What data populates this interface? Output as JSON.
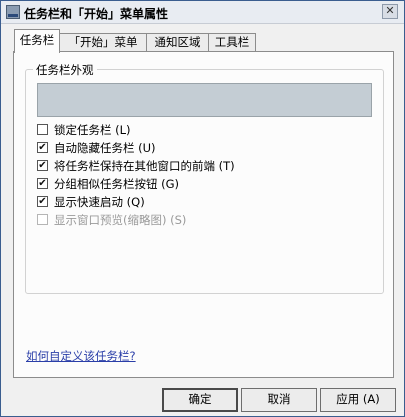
{
  "window": {
    "title": "任务栏和「开始」菜单属性",
    "close_glyph": "✕"
  },
  "tabs": [
    {
      "label": "任务栏",
      "active": true
    },
    {
      "label": "「开始」菜单",
      "active": false
    },
    {
      "label": "通知区域",
      "active": false
    },
    {
      "label": "工具栏",
      "active": false
    }
  ],
  "appearance": {
    "group_label": "任务栏外观",
    "options": [
      {
        "label": "锁定任务栏 (L)",
        "checked": false,
        "enabled": true
      },
      {
        "label": "自动隐藏任务栏 (U)",
        "checked": true,
        "enabled": true
      },
      {
        "label": "将任务栏保持在其他窗口的前端 (T)",
        "checked": true,
        "enabled": true
      },
      {
        "label": "分组相似任务栏按钮 (G)",
        "checked": true,
        "enabled": true
      },
      {
        "label": "显示快速启动 (Q)",
        "checked": true,
        "enabled": true
      },
      {
        "label": "显示窗口预览(缩略图) (S)",
        "checked": false,
        "enabled": false
      }
    ]
  },
  "help_link": "如何自定义该任务栏?",
  "buttons": {
    "ok": "确定",
    "cancel": "取消",
    "apply": "应用 (A)"
  },
  "icons": {
    "window_icon": "taskbar-properties-icon",
    "check_glyph": "✔"
  }
}
